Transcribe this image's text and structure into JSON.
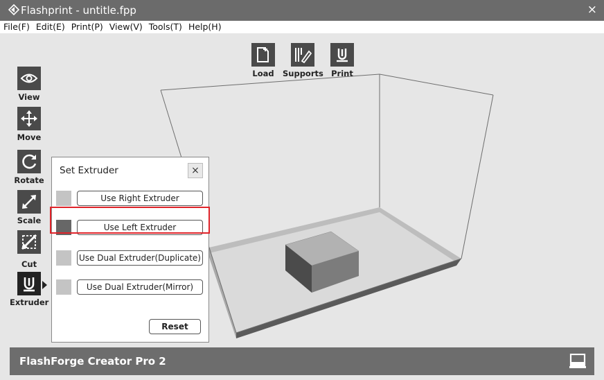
{
  "window": {
    "title": "Flashprint - untitle.fpp",
    "close_glyph": "×",
    "app_icon": "diamond-arrow-icon"
  },
  "menu": {
    "items": [
      "File(F)",
      "Edit(E)",
      "Print(P)",
      "View(V)",
      "Tools(T)",
      "Help(H)"
    ]
  },
  "top_tools": [
    {
      "label": "Load",
      "icon": "load-file-icon"
    },
    {
      "label": "Supports",
      "icon": "supports-icon"
    },
    {
      "label": "Print",
      "icon": "print-icon"
    }
  ],
  "left_tools": [
    {
      "label": "View",
      "icon": "eye-icon"
    },
    {
      "label": "Move",
      "icon": "move-arrows-icon"
    },
    {
      "label": "Rotate",
      "icon": "rotate-icon"
    },
    {
      "label": "Scale",
      "icon": "scale-icon"
    },
    {
      "label": "Cut",
      "icon": "cut-icon"
    },
    {
      "label": "Extruder",
      "icon": "extruder-icon",
      "active": true
    }
  ],
  "extruder_panel": {
    "title": "Set Extruder",
    "close_glyph": "×",
    "options": [
      {
        "label": "Use Right Extruder",
        "swatch": "#c4c4c4"
      },
      {
        "label": "Use Left Extruder",
        "swatch": "#676767"
      },
      {
        "label": "Use Dual Extruder(Duplicate)",
        "swatch": "#c4c4c4",
        "highlighted": true
      },
      {
        "label": "Use Dual Extruder(Mirror)",
        "swatch": "#c4c4c4"
      }
    ],
    "reset_label": "Reset"
  },
  "status": {
    "machine": "FlashForge Creator Pro 2",
    "icon": "printer-icon"
  },
  "colors": {
    "titlebar": "#6b6b6b",
    "toolbox": "#4a4a4a",
    "highlight": "#e0242a",
    "statusbar": "#6d6d6d"
  }
}
